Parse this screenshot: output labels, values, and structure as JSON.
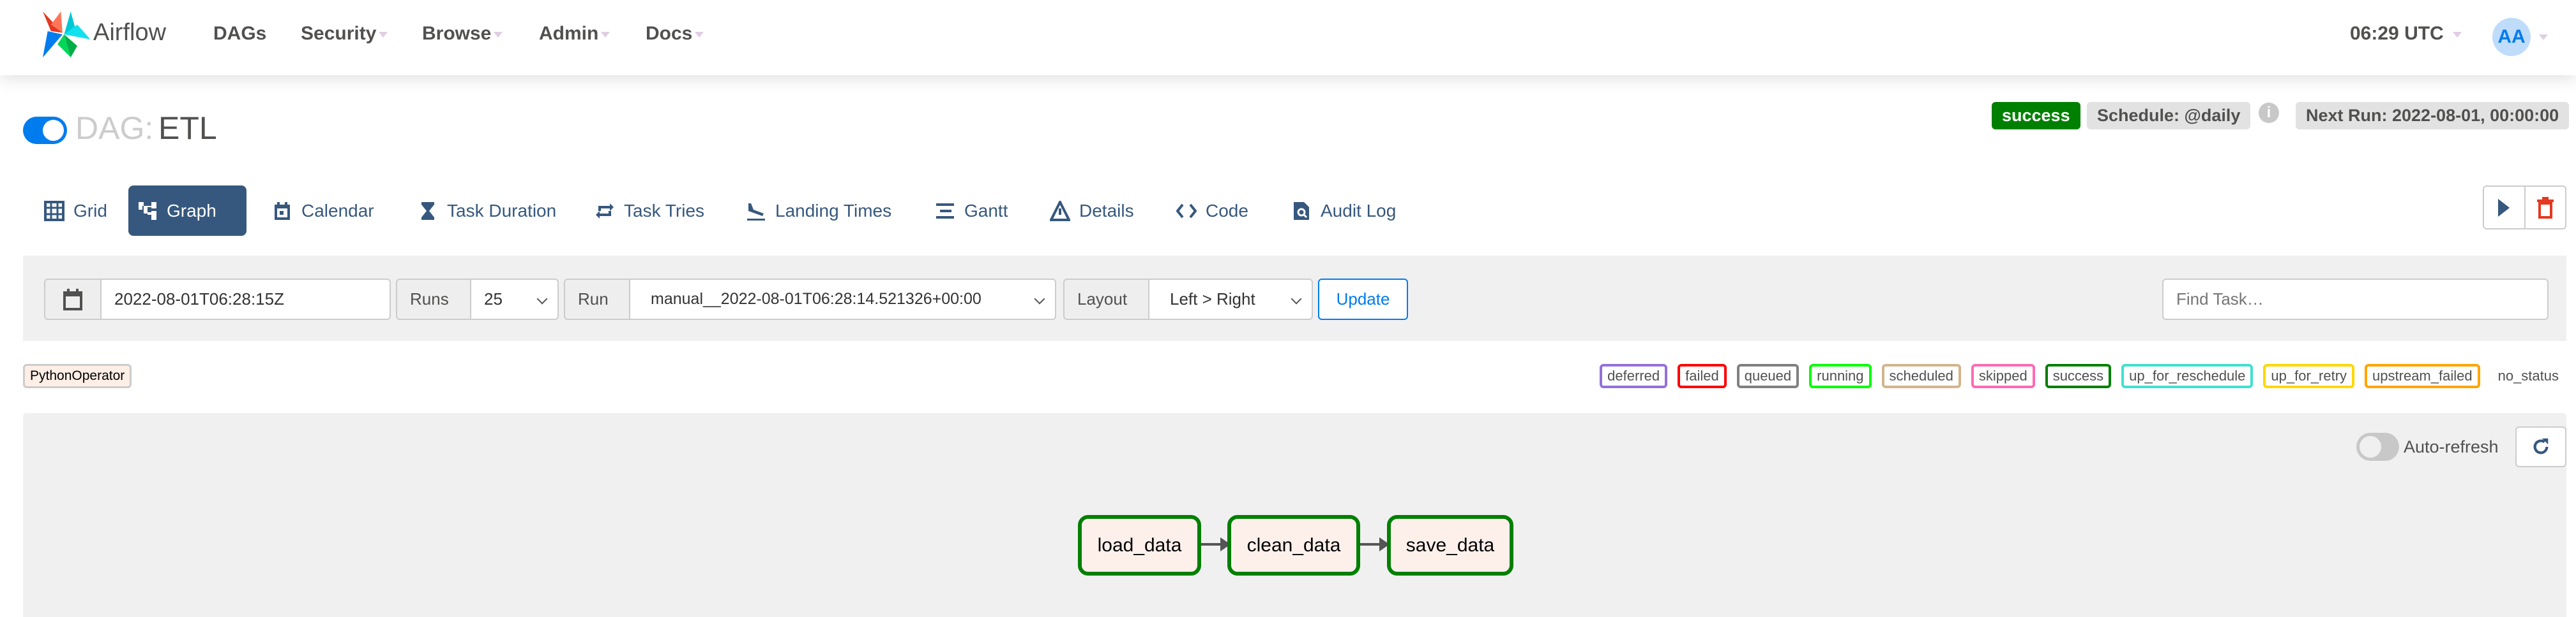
{
  "nav": {
    "brand": "Airflow",
    "items": [
      {
        "label": "DAGs"
      },
      {
        "label": "Security"
      },
      {
        "label": "Browse"
      },
      {
        "label": "Admin"
      },
      {
        "label": "Docs"
      }
    ],
    "time": "06:29 UTC",
    "avatar": "AA"
  },
  "dag": {
    "prefix": "DAG:",
    "name": "ETL",
    "status": "success",
    "schedule": "Schedule: @daily",
    "next_run": "Next Run: 2022-08-01, 00:00:00"
  },
  "tabs": [
    {
      "label": "Grid",
      "icon": "grid-icon"
    },
    {
      "label": "Graph",
      "icon": "graph-icon"
    },
    {
      "label": "Calendar",
      "icon": "calendar-icon"
    },
    {
      "label": "Task Duration",
      "icon": "hourglass-icon"
    },
    {
      "label": "Task Tries",
      "icon": "repeat-icon"
    },
    {
      "label": "Landing Times",
      "icon": "plane-landing-icon"
    },
    {
      "label": "Gantt",
      "icon": "gantt-icon"
    },
    {
      "label": "Details",
      "icon": "warning-triangle-icon"
    },
    {
      "label": "Code",
      "icon": "code-icon"
    },
    {
      "label": "Audit Log",
      "icon": "file-search-icon"
    }
  ],
  "filters": {
    "base_date": "2022-08-01T06:28:15Z",
    "runs_label": "Runs",
    "runs_value": "25",
    "run_label": "Run",
    "run_value": "manual__2022-08-01T06:28:14.521326+00:00",
    "layout_label": "Layout",
    "layout_value": "Left > Right",
    "update": "Update",
    "find_placeholder": "Find Task…"
  },
  "operator": "PythonOperator",
  "states": [
    {
      "label": "deferred",
      "color": "#9370db"
    },
    {
      "label": "failed",
      "color": "#ff0000"
    },
    {
      "label": "queued",
      "color": "#808080"
    },
    {
      "label": "running",
      "color": "#00ff00"
    },
    {
      "label": "scheduled",
      "color": "#d2b48c"
    },
    {
      "label": "skipped",
      "color": "#ff69b4"
    },
    {
      "label": "success",
      "color": "#008000"
    },
    {
      "label": "up_for_reschedule",
      "color": "#40e0d0"
    },
    {
      "label": "up_for_retry",
      "color": "#ffd700"
    },
    {
      "label": "upstream_failed",
      "color": "#ffa500"
    },
    {
      "label": "no_status",
      "color": ""
    }
  ],
  "graph": {
    "auto_refresh": "Auto-refresh",
    "nodes": [
      {
        "label": "load_data"
      },
      {
        "label": "clean_data"
      },
      {
        "label": "save_data"
      }
    ]
  }
}
